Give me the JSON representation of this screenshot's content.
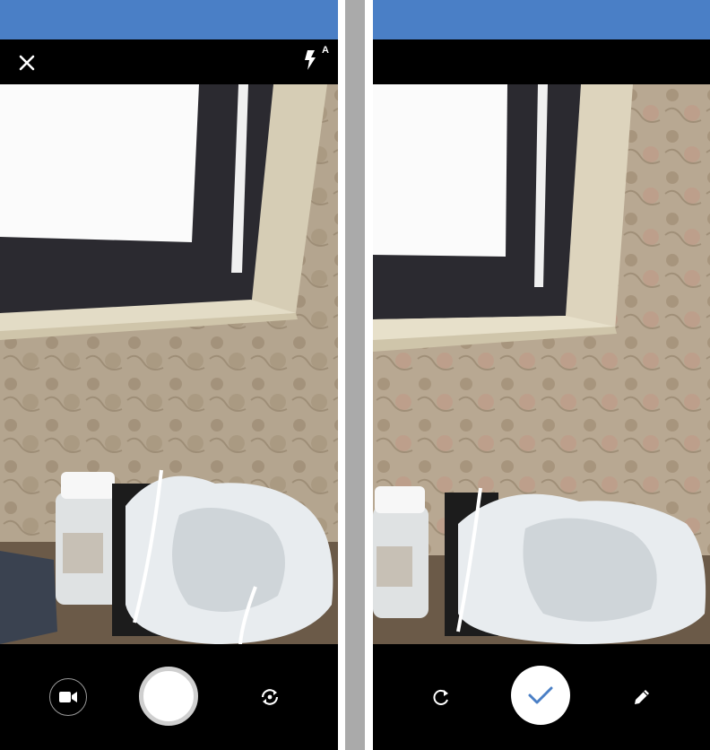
{
  "capture_screen": {
    "flash_badge": "A",
    "icons": {
      "close": "close-icon",
      "flash": "flash-auto-icon",
      "video": "video-camera-icon",
      "shutter": "shutter-button",
      "switch_camera": "switch-camera-icon"
    }
  },
  "review_screen": {
    "icons": {
      "retake": "retake-icon",
      "confirm": "checkmark-icon",
      "edit": "pencil-icon"
    }
  },
  "colors": {
    "status_bar": "#4a7fc6",
    "toolbar": "#000000",
    "confirm_check": "#4a7fc6"
  }
}
